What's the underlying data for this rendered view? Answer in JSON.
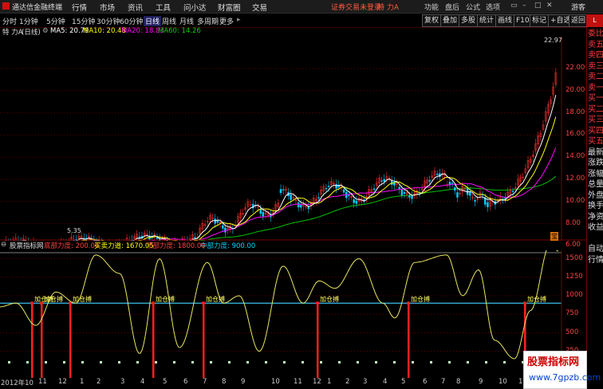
{
  "app": {
    "title": "通达信金融终端"
  },
  "menu": [
    "行情",
    "市场",
    "资讯",
    "工具",
    "问小达",
    "财富圈",
    "交易"
  ],
  "notice": "证券交易未登录",
  "stock_short": "特 力A",
  "right_menu": [
    "功能",
    "盘后",
    "公式",
    "选项"
  ],
  "login": "游客",
  "periods": [
    "分时",
    "1分钟",
    "5分钟",
    "15分钟",
    "30分钟",
    "60分钟",
    "日线",
    "周线",
    "月线",
    "多周期",
    "更多"
  ],
  "active_period": "日线",
  "toolbuttons": [
    "复权",
    "叠加",
    "多股",
    "统计",
    "画线",
    "F10",
    "标记",
    "+自选",
    "返回"
  ],
  "red_label": "L",
  "info": {
    "name": "特 力A",
    "period": "(日线)",
    "ma5": "MA5: 20.79",
    "ma10": "MA10: 20.48",
    "ma20": "MA20: 18.83",
    "ma60": "MA60: 14.26"
  },
  "main_y_ticks": [
    "22.00",
    "20.00",
    "18.00",
    "16.00",
    "14.00",
    "12.00",
    "10.00",
    "8.00",
    "6.00"
  ],
  "high_label": "22.97",
  "low_label": "5.35",
  "quan_label": "宝",
  "indicator": {
    "name": "股票指标网",
    "bottom": "底部力度: 200.00",
    "buysell": "买卖力道: 1670.05",
    "top": "顶部力度: 1800.00",
    "mid": "中部力度: 900.00",
    "signal": "加仓搏",
    "y_ticks": [
      "1500",
      "1250",
      "1000",
      "750",
      "500",
      "250"
    ]
  },
  "x_labels": [
    "2012年10",
    "11",
    "12",
    "1",
    "2",
    "3",
    "4",
    "5",
    "6",
    "7",
    "8",
    "9",
    "10",
    "11",
    "12",
    "1",
    "2",
    "3",
    "4",
    "5",
    "6",
    "7",
    "8",
    "9",
    "10",
    "11",
    "12",
    "1"
  ],
  "sidebar": [
    "委比",
    "卖五",
    "卖四",
    "卖三",
    "卖二",
    "卖一",
    "买一",
    "买二",
    "买三",
    "买四",
    "买五",
    "最新",
    "涨跌",
    "涨幅",
    "总量",
    "外盘",
    "换手",
    "净资",
    "收益"
  ],
  "sidebar2": [
    "自动",
    "行情"
  ],
  "watermark": {
    "line1": "股票指标网",
    "line2": "www.7gpzb.com"
  },
  "colors": {
    "ma5": "#ffffff",
    "ma10": "#ffff00",
    "ma20": "#ff00ff",
    "ma60": "#00c000",
    "up": "#ff3030",
    "down": "#00c8ff",
    "axis": "#ff4040"
  }
}
